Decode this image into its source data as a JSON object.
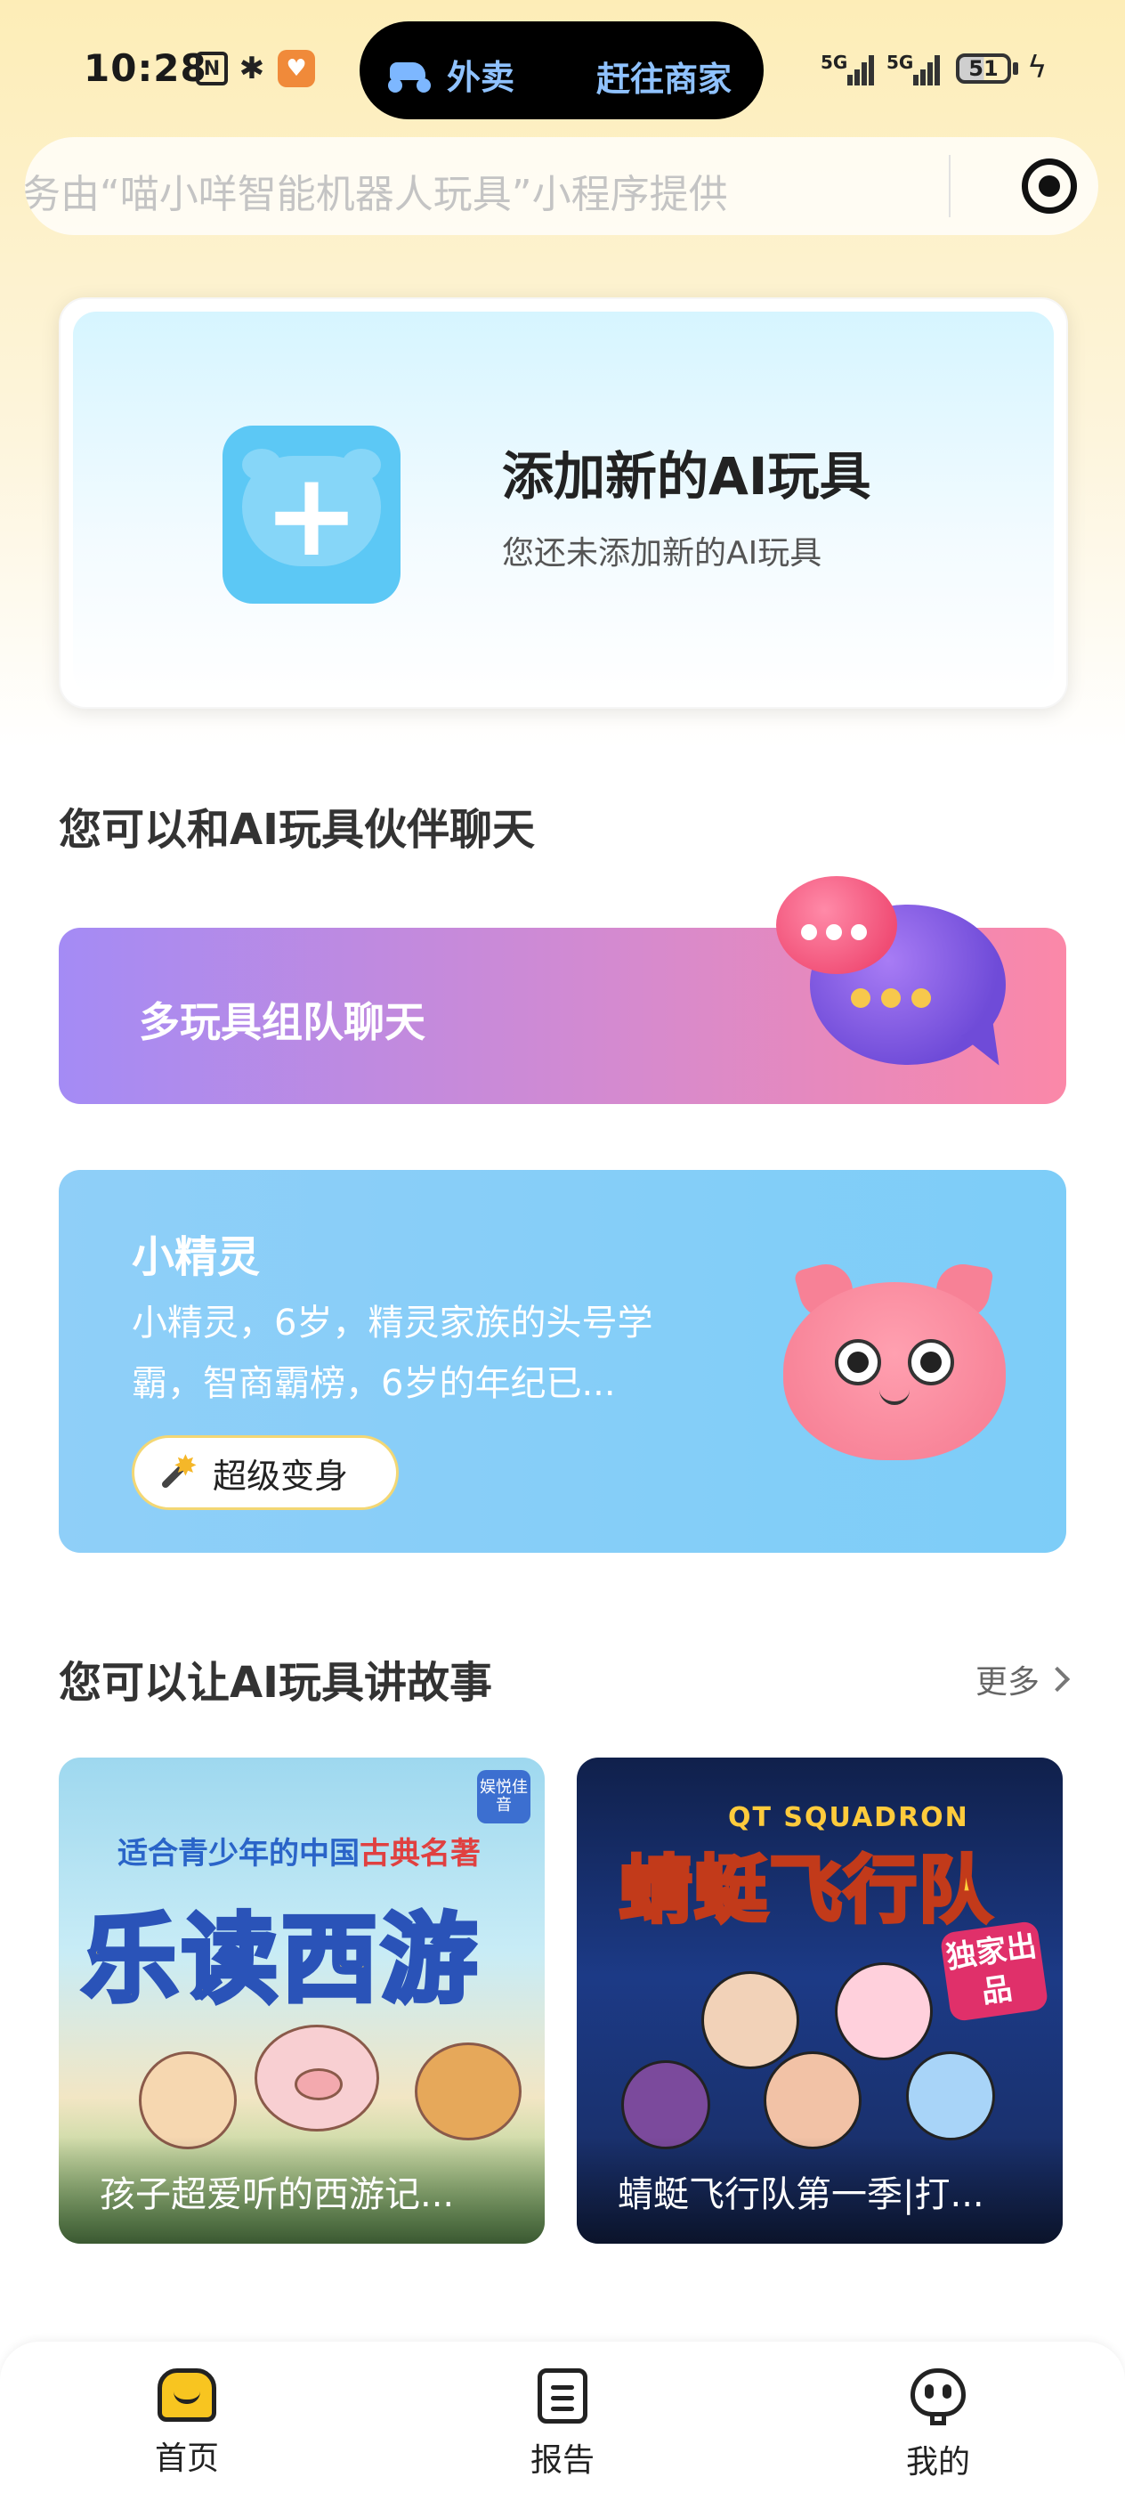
{
  "status_bar": {
    "time": "10:28",
    "island_left_label": "外卖",
    "island_right_label": "赶往商家",
    "signal1": "5G",
    "signal2": "5G",
    "battery": "51"
  },
  "search": {
    "placeholder": "务由“喵小咩智能机器人玩具”小程序提供"
  },
  "add_card": {
    "title": "添加新的AI玩具",
    "subtitle": "您还未添加新的AI玩具"
  },
  "chat_section": {
    "title": "您可以和AI玩具伙伴聊天",
    "team_banner_label": "多玩具组队聊天",
    "sprite": {
      "name": "小精灵",
      "description": "小精灵，6岁，精灵家族的头号学霸，智商霸榜，6岁的年纪已...",
      "button_label": "超级变身"
    }
  },
  "story_section": {
    "title": "您可以让AI玩具讲故事",
    "more_label": "更多",
    "stories": [
      {
        "title": "孩子超爱听的西游记...",
        "cover_top_text": "适合青少年的中国",
        "cover_top_highlight": "古典名著",
        "cover_title": "乐读西游",
        "cover_logo": "娱悦佳音"
      },
      {
        "title": "蜻蜓飞行队第一季|打...",
        "cover_sub": "QT SQUADRON",
        "cover_title": "蜻蜓飞行队",
        "cover_badge": "独家出品"
      }
    ]
  },
  "bottom_nav": {
    "items": [
      {
        "label": "首页",
        "icon": "home-icon"
      },
      {
        "label": "报告",
        "icon": "report-icon"
      },
      {
        "label": "我的",
        "icon": "profile-icon"
      }
    ]
  },
  "colors": {
    "accent_yellow": "#f8c520",
    "sprite_card_blue": "#7dcdf8",
    "team_banner_start": "#a48bf5",
    "team_banner_end": "#fb88a8"
  }
}
